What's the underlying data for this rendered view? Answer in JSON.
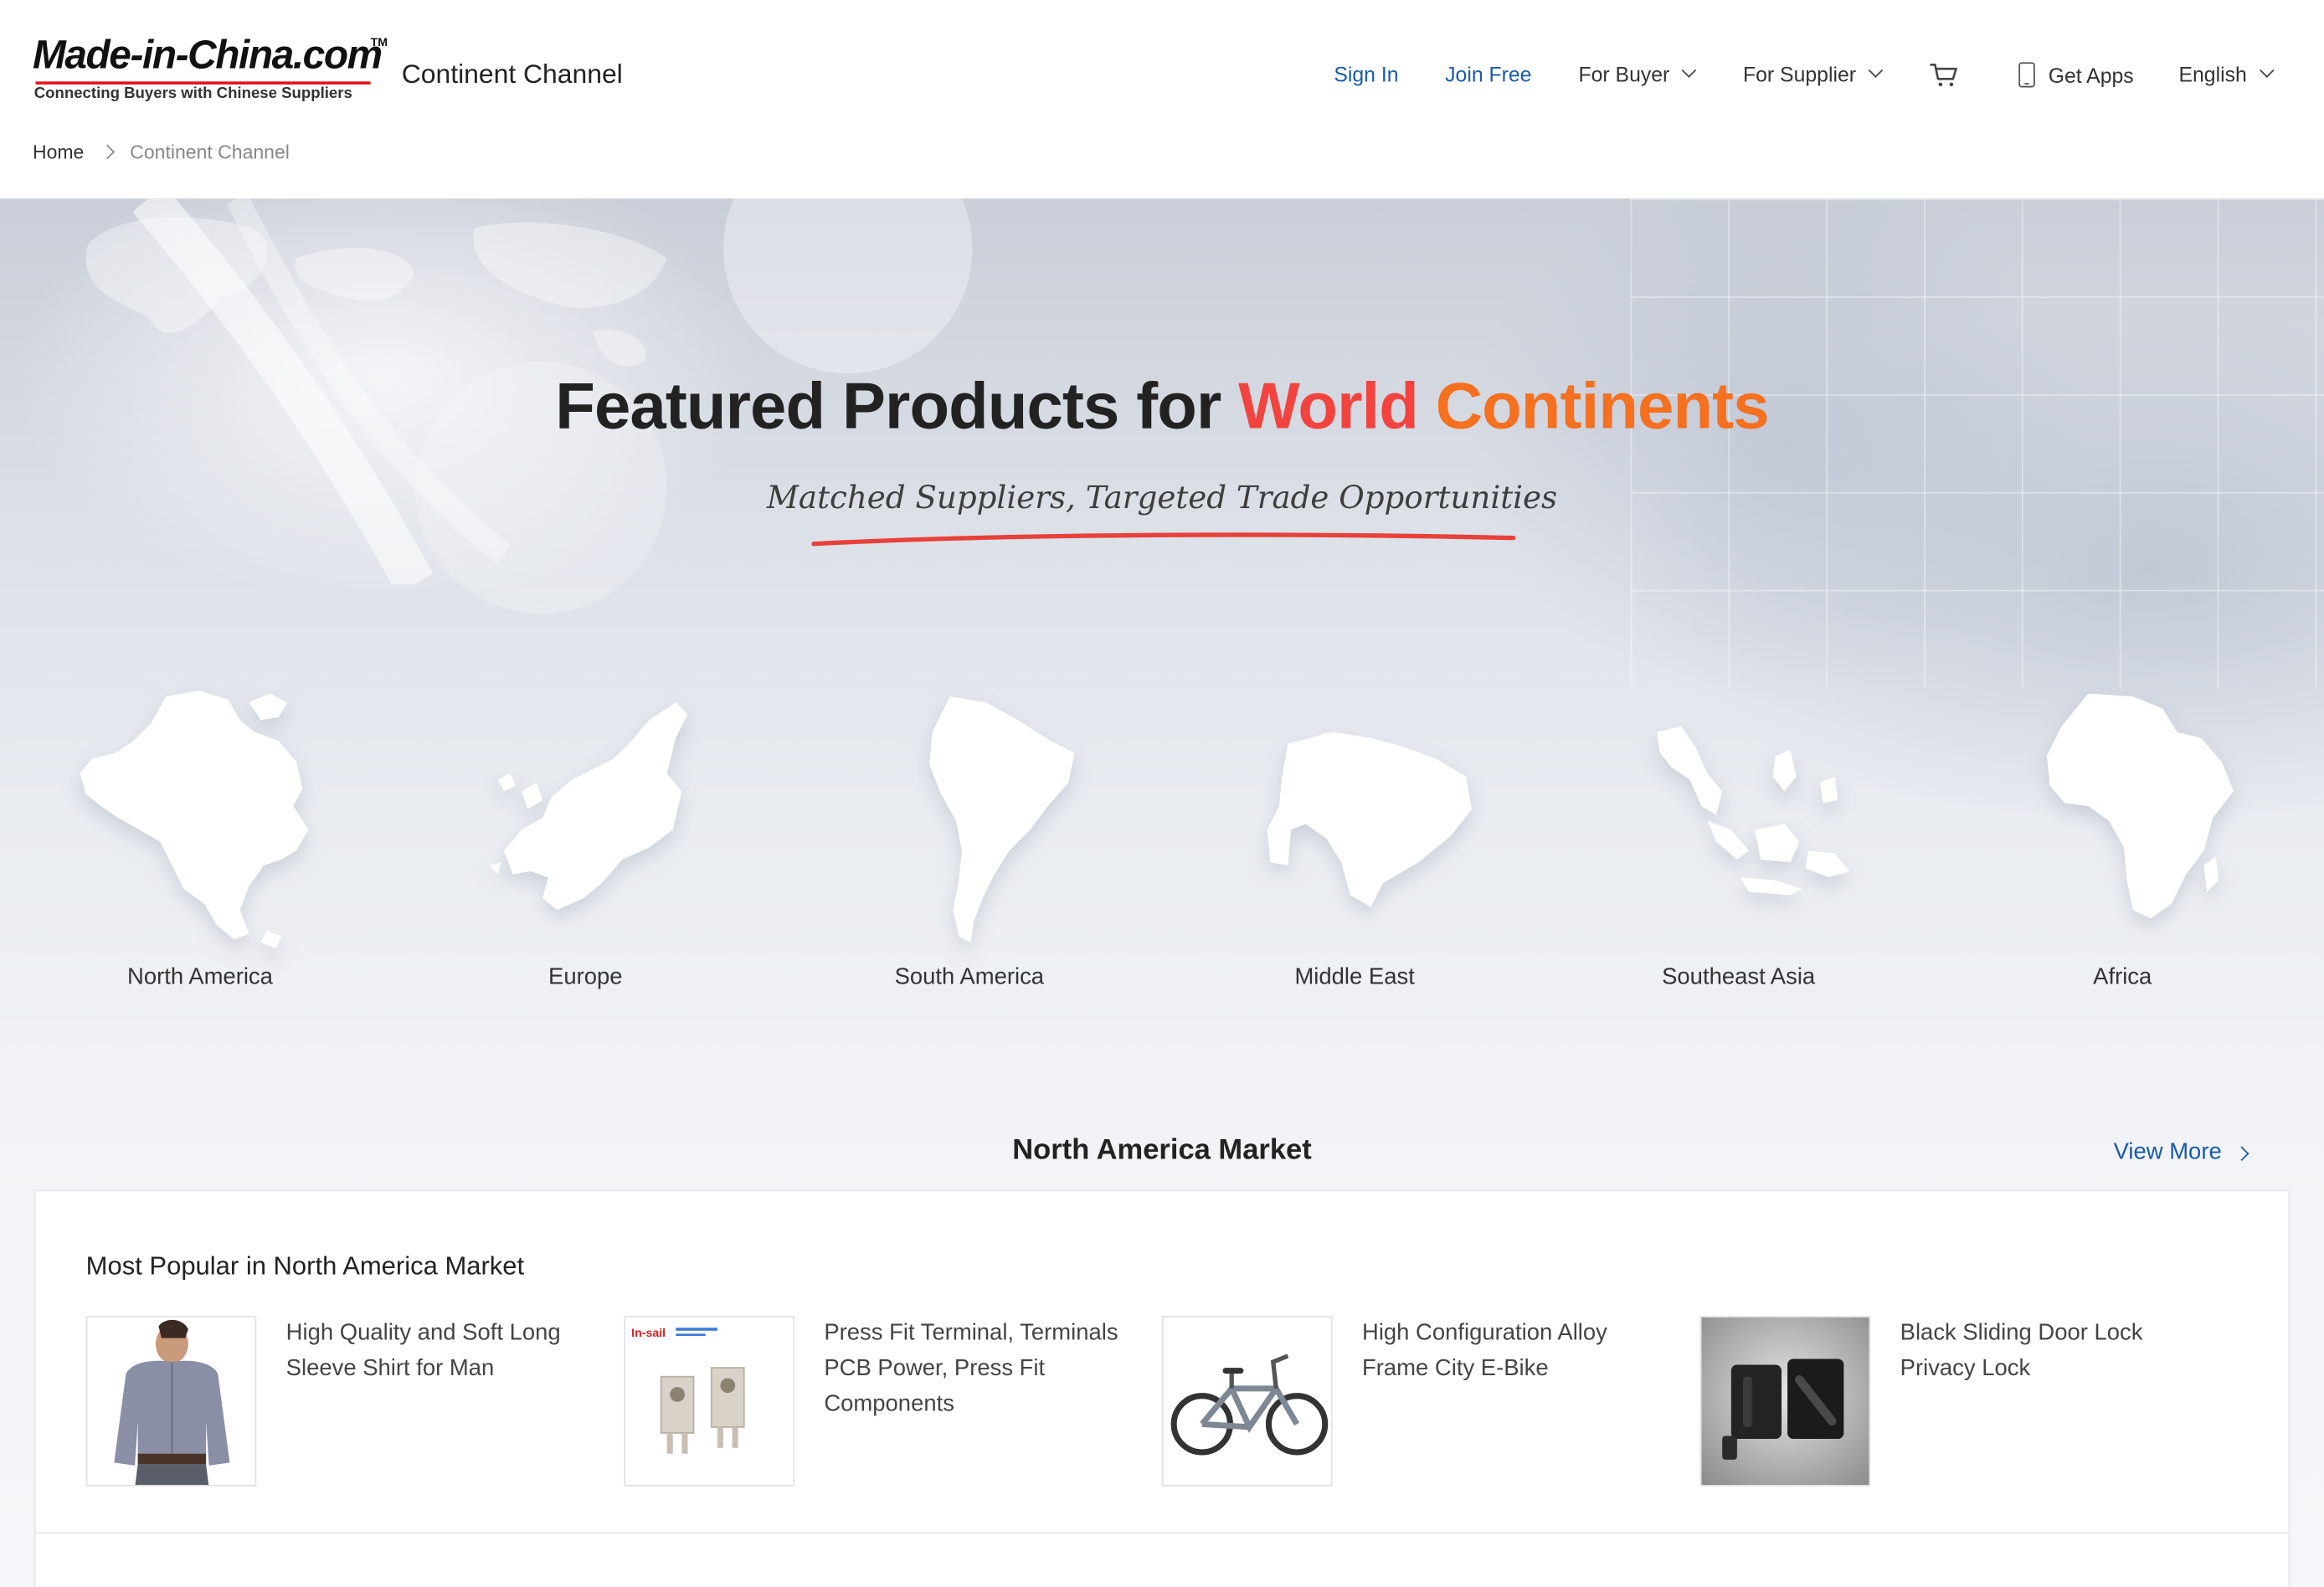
{
  "header": {
    "logo_text": "Made-in-China.com",
    "logo_tagline": "Connecting Buyers with Chinese Suppliers",
    "logo_tm": "TM",
    "channel_title": "Continent Channel",
    "nav": {
      "sign_in": "Sign In",
      "join_free": "Join Free",
      "for_buyer": "For Buyer",
      "for_supplier": "For Supplier",
      "cart_icon": "shopping-cart-icon",
      "get_apps": "Get Apps",
      "language": "English"
    }
  },
  "breadcrumb": {
    "home": "Home",
    "current": "Continent Channel"
  },
  "hero": {
    "title_part1": "Featured Products for ",
    "title_part2": "World ",
    "title_part3": "Continents",
    "subtitle": "Matched Suppliers, Targeted Trade Opportunities",
    "colors": {
      "world": "#f2433e",
      "continents": "#f5701f",
      "underline": "#e8403a"
    }
  },
  "continents": [
    {
      "label": "North America"
    },
    {
      "label": "Europe"
    },
    {
      "label": "South America"
    },
    {
      "label": "Middle East"
    },
    {
      "label": "Southeast Asia"
    },
    {
      "label": "Africa"
    }
  ],
  "market": {
    "title": "North America Market",
    "view_more": "View More",
    "panel_title": "Most Popular in North America Market",
    "products": [
      {
        "name": "High Quality and Soft Long Sleeve Shirt for Man"
      },
      {
        "name": "Press Fit Terminal, Terminals PCB Power, Press Fit Components",
        "thumb_brand": "In-sail"
      },
      {
        "name": "High Configuration Alloy Frame City E-Bike"
      },
      {
        "name": "Black Sliding Door Lock Privacy Lock"
      }
    ]
  },
  "theme": {
    "link_blue": "#1a5aa8",
    "brand_red": "#e3101b"
  }
}
